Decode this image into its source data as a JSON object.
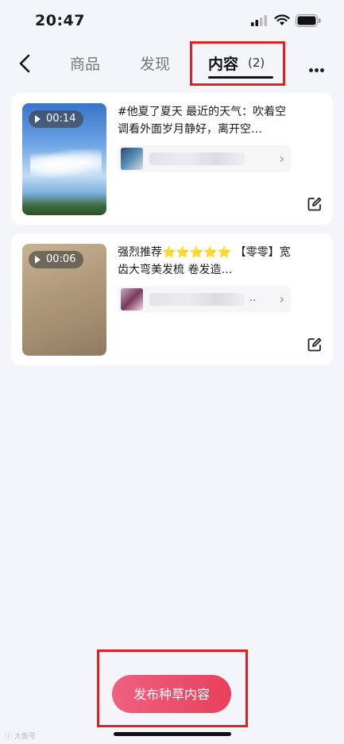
{
  "status_bar": {
    "time": "20:47"
  },
  "header": {
    "tabs": [
      {
        "label": "商品"
      },
      {
        "label": "发现"
      },
      {
        "label": "内容",
        "count": "(2)",
        "active": true
      }
    ]
  },
  "cards": [
    {
      "duration": "00:14",
      "description": "#他夏了夏天 最近的天气：吹着空调看外面岁月静好，离开空…",
      "product_name": ""
    },
    {
      "duration": "00:06",
      "description": "强烈推荐⭐⭐⭐⭐⭐ 【零零】宽齿大弯美发梳 卷发造…",
      "product_name": ".."
    }
  ],
  "publish_button": {
    "label": "发布种草内容"
  },
  "watermark": {
    "text": "ⓘ 大鱼号"
  },
  "colors": {
    "accent": "#e8405c",
    "highlight_box": "#e0211f"
  },
  "icons": [
    "back-arrow-icon",
    "more-icon",
    "play-icon",
    "chevron-right-icon",
    "edit-icon"
  ]
}
